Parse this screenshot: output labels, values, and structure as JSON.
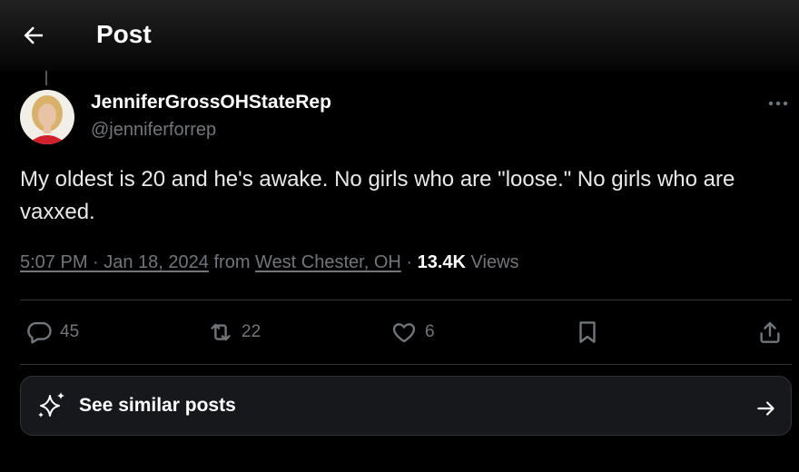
{
  "header": {
    "title": "Post"
  },
  "author": {
    "display_name": "JenniferGrossOHStateRep",
    "handle": "@jenniferforrep"
  },
  "post": {
    "text": "My oldest is 20 and he's awake. No girls who are \"loose.\" No girls who are vaxxed.",
    "time": "5:07 PM · Jan 18, 2024",
    "from_label": " from ",
    "location": "West Chester, OH",
    "separator": " · ",
    "views_count": "13.4K",
    "views_label": " Views"
  },
  "actions": {
    "replies": "45",
    "reposts": "22",
    "likes": "6"
  },
  "similar": {
    "label": "See similar posts"
  },
  "icons": {
    "back": "arrow-left-icon",
    "more": "more-horizontal-icon",
    "reply": "speech-bubble-icon",
    "repost": "repost-icon",
    "like": "heart-icon",
    "bookmark": "bookmark-icon",
    "share": "share-icon",
    "sparkle": "sparkle-icon",
    "arrow": "arrow-right-icon"
  },
  "colors": {
    "background": "#000000",
    "text": "#e7e9ea",
    "secondary": "#71767b",
    "divider": "#2f3336"
  }
}
